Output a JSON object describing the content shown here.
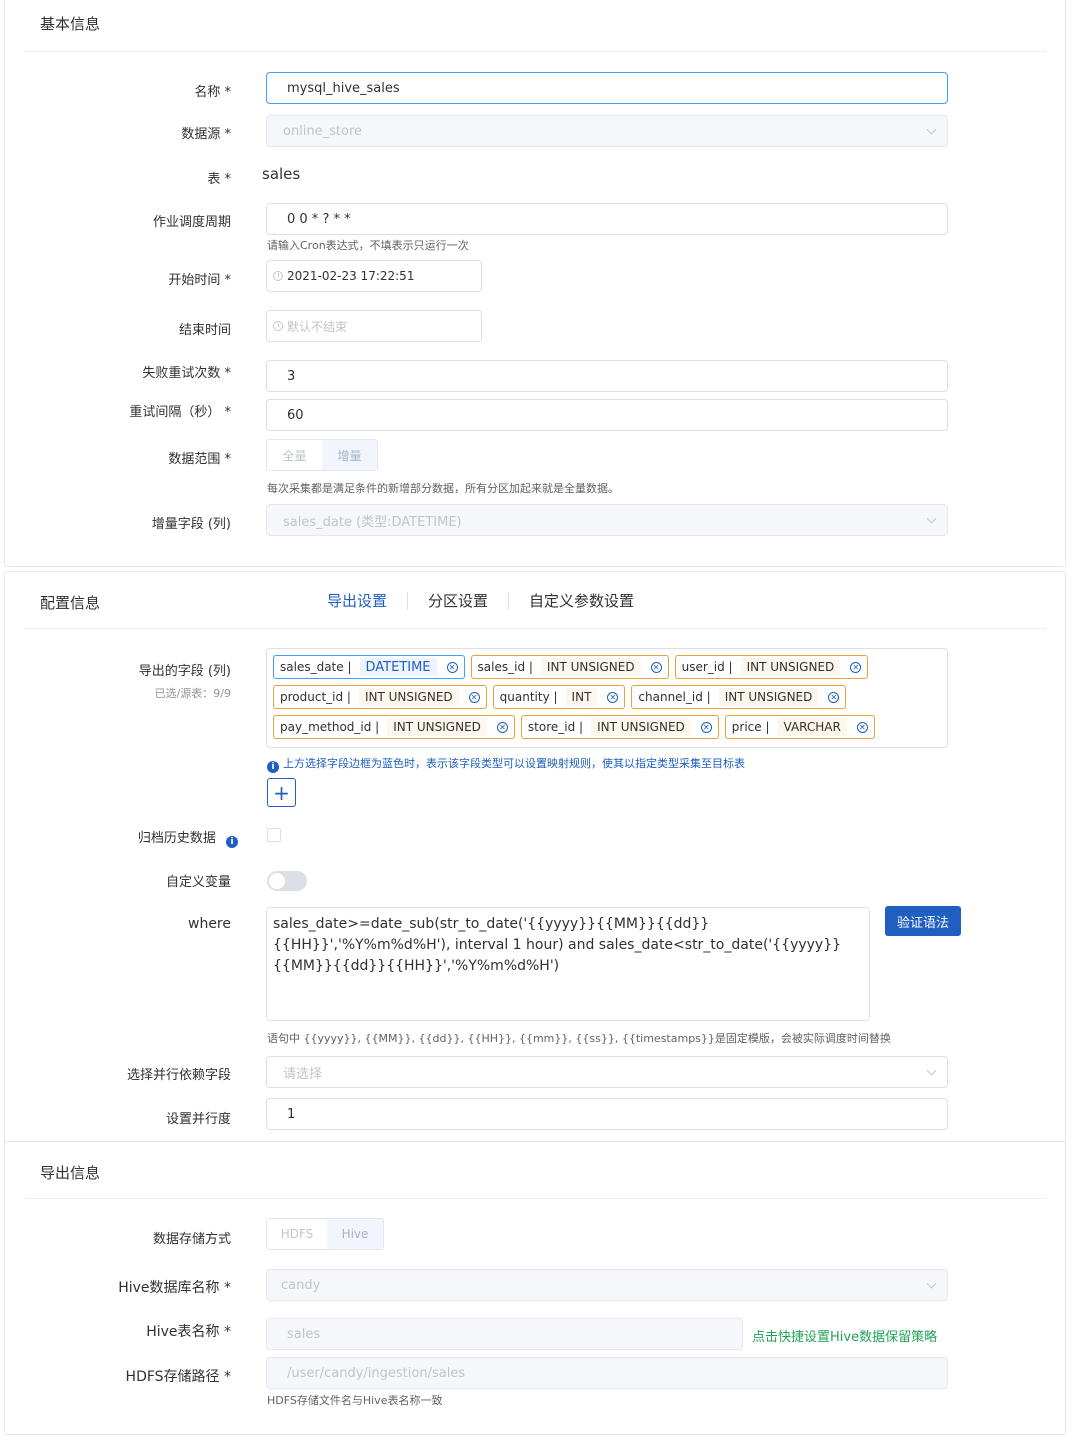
{
  "basic": {
    "title": "基本信息",
    "name_label": "名称 *",
    "name_value": "mysql_hive_sales",
    "datasource_label": "数据源 *",
    "datasource_value": "online_store",
    "table_label": "表 *",
    "table_value": "sales",
    "cron_label": "作业调度周期",
    "cron_value": "0 0 * ? * *",
    "cron_hint": "请输入Cron表达式，不填表示只运行一次",
    "start_label": "开始时间 *",
    "start_value": "2021-02-23 17:22:51",
    "end_label": "结束时间",
    "end_placeholder": "默认不结束",
    "retry_label": "失败重试次数 *",
    "retry_value": "3",
    "interval_label": "重试间隔（秒） *",
    "interval_value": "60",
    "range_label": "数据范围 *",
    "range_options": [
      "全量",
      "增量"
    ],
    "range_selected": "增量",
    "range_hint": "每次采集都是满足条件的新增部分数据，所有分区加起来就是全量数据。",
    "incr_label": "增量字段 (列)",
    "incr_value": "sales_date (类型:DATETIME)"
  },
  "config": {
    "title": "配置信息",
    "tabs": [
      "导出设置",
      "分区设置",
      "自定义参数设置"
    ],
    "active_tab": "导出设置",
    "fields_label": "导出的字段 (列)",
    "fields_count": "已选/源表：9/9",
    "fields": [
      {
        "name": "sales_date |",
        "type": "DATETIME",
        "highlight": true
      },
      {
        "name": "sales_id |",
        "type": "INT UNSIGNED",
        "highlight": false
      },
      {
        "name": "user_id |",
        "type": "INT UNSIGNED",
        "highlight": false
      },
      {
        "name": "product_id |",
        "type": "INT UNSIGNED",
        "highlight": false
      },
      {
        "name": "quantity |",
        "type": "INT",
        "highlight": false
      },
      {
        "name": "channel_id |",
        "type": "INT UNSIGNED",
        "highlight": false
      },
      {
        "name": "pay_method_id |",
        "type": "INT UNSIGNED",
        "highlight": false
      },
      {
        "name": "store_id |",
        "type": "INT UNSIGNED",
        "highlight": false
      },
      {
        "name": "price |",
        "type": "VARCHAR",
        "highlight": false
      }
    ],
    "fields_hint": "上方选择字段边框为蓝色时，表示该字段类型可以设置映射规则，使其以指定类型采集至目标表",
    "add_icon": "+",
    "archive_label": "归档历史数据",
    "custom_var_label": "自定义变量",
    "where_label": "where",
    "where_value": "sales_date>=date_sub(str_to_date('{{yyyy}}{{MM}}{{dd}}{{HH}}','%Y%m%d%H'), interval 1 hour) and sales_date<str_to_date('{{yyyy}}{{MM}}{{dd}}{{HH}}','%Y%m%d%H')",
    "verify_button": "验证语法",
    "where_hint": "语句中 {{yyyy}}, {{MM}}, {{dd}}, {{HH}}, {{mm}}, {{ss}}, {{timestamps}}是固定模版，会被实际调度时间替换",
    "parallel_field_label": "选择并行依赖字段",
    "parallel_field_placeholder": "请选择",
    "parallel_label": "设置并行度",
    "parallel_value": "1"
  },
  "export": {
    "title": "导出信息",
    "storage_label": "数据存储方式",
    "storage_options": [
      "HDFS",
      "Hive"
    ],
    "storage_selected": "Hive",
    "db_label": "Hive数据库名称 *",
    "db_value": "candy",
    "table_label": "Hive表名称 *",
    "table_value": "sales",
    "retention_link": "点击快捷设置Hive数据保留策略",
    "path_label": "HDFS存储路径 *",
    "path_value": "/user/candy/ingestion/sales",
    "path_hint": "HDFS存储文件名与Hive表名称一致"
  }
}
